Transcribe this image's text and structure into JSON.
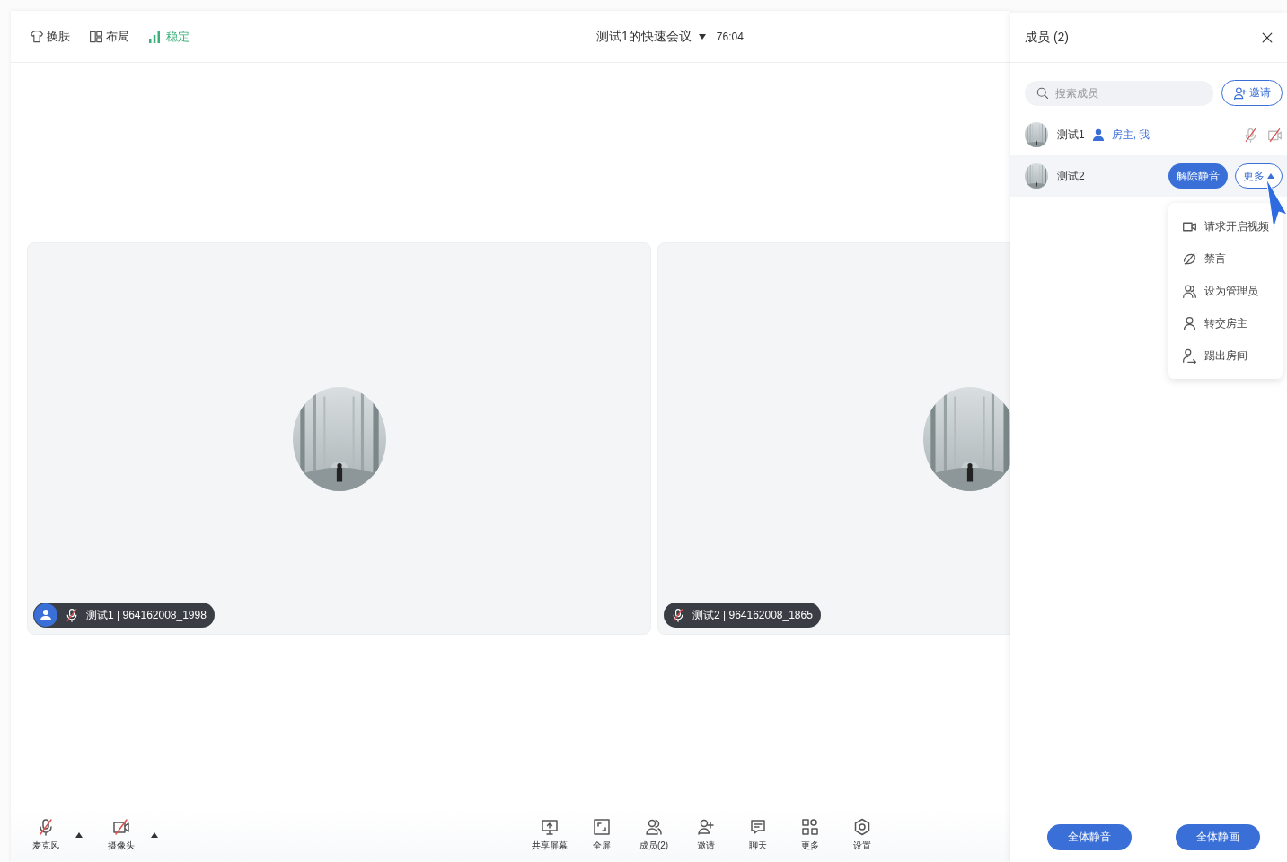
{
  "top_bar": {
    "items": [
      {
        "kind": "skin",
        "label": "换肤"
      },
      {
        "kind": "layout",
        "label": "布局"
      },
      {
        "kind": "signal",
        "label": "稳定"
      }
    ],
    "meeting_title": "测试1的快速会议",
    "duration": "76:04"
  },
  "videos": [
    {
      "label": "测试1 | 964162008_1998",
      "host": true,
      "mic_muted": true
    },
    {
      "label": "测试2 | 964162008_1865",
      "host": false,
      "mic_muted": true
    }
  ],
  "bottom_bar": {
    "devices": [
      {
        "kind": "mic",
        "label": "麦克风",
        "muted": true
      },
      {
        "kind": "camera",
        "label": "摄像头",
        "muted": true
      }
    ],
    "actions": [
      {
        "kind": "share",
        "label": "共享屏幕"
      },
      {
        "kind": "fullscreen",
        "label": "全屏"
      },
      {
        "kind": "members",
        "label": "成员(2)"
      },
      {
        "kind": "invite",
        "label": "邀请"
      },
      {
        "kind": "chat",
        "label": "聊天"
      },
      {
        "kind": "more",
        "label": "更多"
      },
      {
        "kind": "settings",
        "label": "设置"
      }
    ]
  },
  "members_panel": {
    "title": "成员 (2)",
    "search": {
      "placeholder": "搜索成员"
    },
    "invite_button": "邀请",
    "members": [
      {
        "name": "测试1",
        "role": "房主, 我",
        "host": true,
        "selected": false,
        "mic_muted": true,
        "camera_muted": true
      },
      {
        "name": "测试2",
        "host": false,
        "selected": true,
        "unmute_button": "解除静音",
        "more_button": "更多"
      }
    ],
    "menu": [
      {
        "kind": "video",
        "label": "请求开启视频"
      },
      {
        "kind": "mute",
        "label": "禁言"
      },
      {
        "kind": "admin",
        "label": "设为管理员"
      },
      {
        "kind": "owner",
        "label": "转交房主"
      },
      {
        "kind": "kick",
        "label": "踢出房间"
      }
    ],
    "footer_buttons": [
      "全体静音",
      "全体静画"
    ]
  }
}
